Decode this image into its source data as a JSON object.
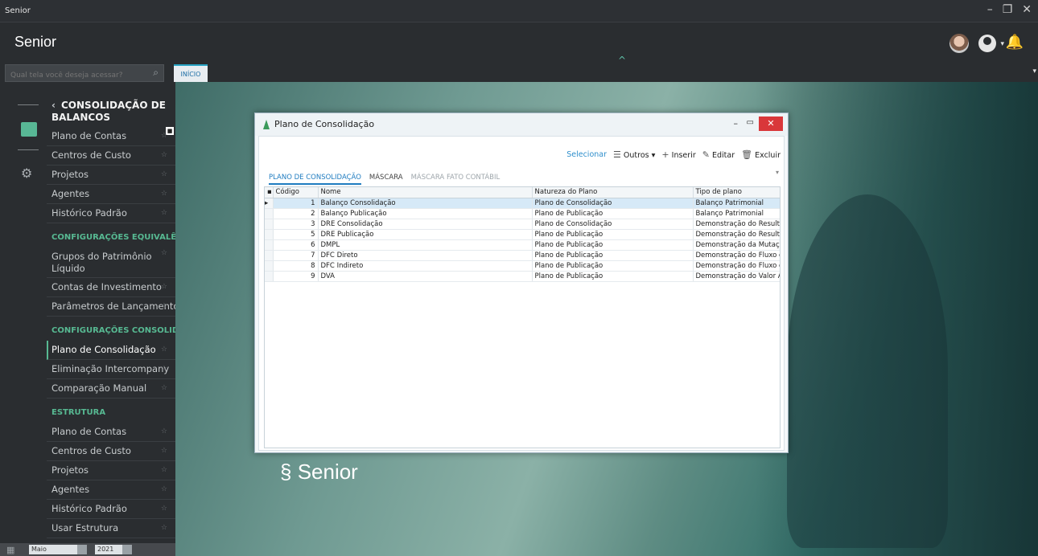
{
  "window": {
    "title": "Senior",
    "controls": [
      "–",
      "❐",
      "✕"
    ]
  },
  "header": {
    "logo": "Senior",
    "collapse_glyph": "^",
    "bell_icon": "bell-icon"
  },
  "search": {
    "placeholder": "Qual tela você deseja acessar?"
  },
  "tabs_main": {
    "active": "INÍCIO"
  },
  "sidebar": {
    "module_title": "CONSOLIDAÇÃO DE BALANCOS",
    "sections": [
      {
        "heading": "",
        "items": [
          "Plano de Contas",
          "Centros de Custo",
          "Projetos",
          "Agentes",
          "Histórico Padrão"
        ]
      },
      {
        "heading": "CONFIGURAÇÕES EQUIVALÊNC",
        "items": [
          "Grupos do Patrimônio Líquido",
          "Contas de Investimento",
          "Parâmetros de Lançamentos"
        ]
      },
      {
        "heading": "CONFIGURAÇÕES CONSOLIDA",
        "items": [
          "Plano de Consolidação",
          "Eliminação Intercompany",
          "Comparação Manual"
        ]
      },
      {
        "heading": "ESTRUTURA",
        "items": [
          "Plano de Contas",
          "Centros de Custo",
          "Projetos",
          "Agentes",
          "Histórico Padrão",
          "Usar Estrutura"
        ]
      }
    ]
  },
  "footer": {
    "month": "Maio",
    "year": "2021"
  },
  "background": {
    "brand": "Senior"
  },
  "dialog": {
    "title": "Plano de Consolidação",
    "toolbar": {
      "select": "Selecionar",
      "others": "Outros",
      "insert": "Inserir",
      "edit": "Editar",
      "delete": "Excluir"
    },
    "tabs": [
      "PLANO DE CONSOLIDAÇÃO",
      "MÁSCARA",
      "MÁSCARA FATO CONTÁBIL"
    ],
    "columns": [
      "Código",
      "Nome",
      "Natureza do Plano",
      "Tipo de plano"
    ],
    "rows": [
      [
        "1",
        "Balanço Consolidação",
        "Plano de Consolidação",
        "Balanço Patrimonial"
      ],
      [
        "2",
        "Balanço Publicação",
        "Plano de Publicação",
        "Balanço Patrimonial"
      ],
      [
        "3",
        "DRE Consolidação",
        "Plano de Consolidação",
        "Demonstração do Resulta"
      ],
      [
        "5",
        "DRE Publicação",
        "Plano de Publicação",
        "Demonstração do Resulta"
      ],
      [
        "6",
        "DMPL",
        "Plano de Publicação",
        "Demonstração da Mutaç"
      ],
      [
        "7",
        "DFC Direto",
        "Plano de Publicação",
        "Demonstração do Fluxo d"
      ],
      [
        "8",
        "DFC Indireto",
        "Plano de Publicação",
        "Demonstração do Fluxo d"
      ],
      [
        "9",
        "DVA",
        "Plano de Publicação",
        "Demonstração do Valor A"
      ]
    ]
  }
}
